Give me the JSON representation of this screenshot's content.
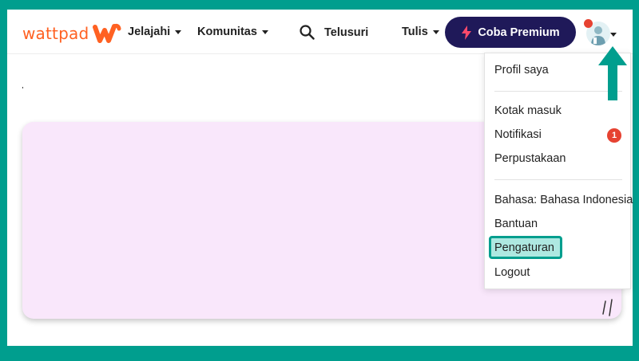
{
  "brand": {
    "name": "wattpad",
    "color": "#ff6122"
  },
  "nav": {
    "explore_label": "Jelajahi",
    "community_label": "Komunitas",
    "search_label": "Telusuri",
    "write_label": "Tulis",
    "premium_label": "Coba Premium",
    "search_icon": "search-icon",
    "lightning_icon": "lightning-icon"
  },
  "menu": {
    "profile": "Profil saya",
    "inbox": "Kotak masuk",
    "notifications": "Notifikasi",
    "notification_count": "1",
    "library": "Perpustakaan",
    "language": "Bahasa: Bahasa Indonesia",
    "help": "Bantuan",
    "settings": "Pengaturan",
    "logout": "Logout"
  },
  "colors": {
    "frame": "#009e8e",
    "premium_bg": "#1f1959",
    "premium_icon": "#ff4a6b",
    "badge": "#e64231",
    "card_bg": "#f9e7fb",
    "highlight": "#009e8e"
  }
}
